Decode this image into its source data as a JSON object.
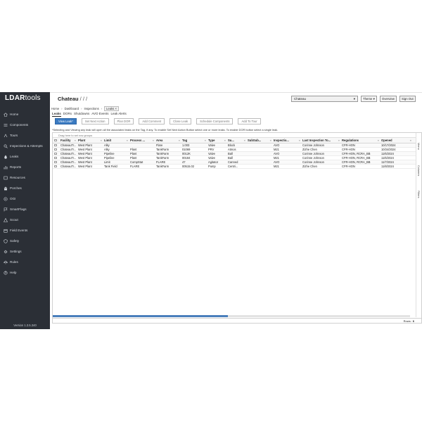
{
  "app": {
    "logo_bold": "LDAR",
    "logo_light": "tools",
    "version": "Version 1.3.5.340"
  },
  "sidebar": {
    "items": [
      {
        "label": "Home",
        "icon": "home-icon"
      },
      {
        "label": "Components",
        "icon": "components-icon"
      },
      {
        "label": "Tours",
        "icon": "tours-icon"
      },
      {
        "label": "Inspections & Attempts",
        "icon": "inspections-icon"
      },
      {
        "label": "Leaks",
        "icon": "leaks-icon"
      },
      {
        "label": "Reports",
        "icon": "reports-icon"
      },
      {
        "label": "Resources",
        "icon": "resources-icon"
      },
      {
        "label": "Porches",
        "icon": "porches-icon"
      },
      {
        "label": "OGI",
        "icon": "ogi-icon"
      },
      {
        "label": "SmartFlags",
        "icon": "flag-icon"
      },
      {
        "label": "Scout",
        "icon": "scout-icon"
      },
      {
        "label": "Field Events",
        "icon": "field-events-icon"
      },
      {
        "label": "Safety",
        "icon": "safety-icon"
      },
      {
        "label": "Settings",
        "icon": "gear-icon"
      },
      {
        "label": "Rules",
        "icon": "rules-icon"
      },
      {
        "label": "Help",
        "icon": "help-icon"
      }
    ]
  },
  "header": {
    "title": "Chateau",
    "title_suffix": " / / /",
    "site_value": "Chateau",
    "site_caret": "▾",
    "theme_label": "Theme ▾",
    "overview_label": "Overview",
    "signout_label": "Sign Out"
  },
  "breadcrumb": {
    "items": [
      "Home",
      "Dashboard",
      "Inspections"
    ],
    "sep": "›",
    "active": "Leaks",
    "close": "×"
  },
  "subtabs": [
    "Leaks",
    "DORs",
    "Shutdowns",
    "AVO Events",
    "Leak Alerts"
  ],
  "actions": {
    "view": "View Leak*",
    "next": "Set Next Action",
    "plan": "Plan DOR",
    "comment": "Add Comment",
    "close": "Close Leak",
    "schedule": "Schedule Components",
    "tour": "Add To Tour"
  },
  "hint": "*Selecting and Viewing any leak will open all the associated leaks on the Tag, if any. To enable Set Next Action Button select one or more leaks. To enable DOR button select a single leak.",
  "grid": {
    "group_panel": "Drag here to set row groups",
    "menu_glyph": "≡",
    "columns": [
      "Facility",
      "Plant",
      "Limit",
      "Process ...",
      "Area",
      "Tag",
      "Type",
      "Su...",
      "SubSub...",
      "Inspectio...",
      "Last Inspection To...",
      "Regulations",
      "Opened"
    ],
    "rows": [
      [
        "ChateauTr...",
        "West Plant",
        "Alky",
        "",
        "Flare",
        "1.003",
        "Valve",
        "Block",
        "",
        "AVO",
        "Corinne Johnson",
        "CFR-HON",
        "10/17/2024"
      ],
      [
        "ChateauTr...",
        "West Plant",
        "Alky",
        "Plant",
        "TankFarm",
        "01069",
        "PRV",
        "Atmos",
        "",
        "M21",
        "Zizhe Chen",
        "CFR-HON",
        "10/24/2024"
      ],
      [
        "ChateauTr...",
        "West Plant",
        "Pipeline",
        "Plant",
        "TankFarm",
        "0012K",
        "Valve",
        "Ball",
        "",
        "AVO",
        "Corinne Johnson",
        "CFR-HON, RCRA_BB",
        "11/6/2024"
      ],
      [
        "ChateauTr...",
        "West Plant",
        "Pipeline",
        "Plant",
        "TankFarm",
        "00184",
        "Valve",
        "Ball",
        "",
        "M21",
        "Corinne Johnson",
        "CFR-HON, RCRA_BB",
        "11/6/2024"
      ],
      [
        "ChateauTr...",
        "West Plant",
        "Limit",
        "CompStat",
        "FLARE",
        "47",
        "Agitator",
        "Canned",
        "",
        "AVO",
        "Corinne Johnson",
        "CFR-HON, RCRA_BB",
        "11/7/2024"
      ],
      [
        "ChateauTr...",
        "West Plant",
        "Tank Field",
        "FLARE",
        "TankFarm",
        "00515.02",
        "Pump",
        "Centri...",
        "",
        "M21",
        "Zizhe Chen",
        "CFR-HON",
        "11/8/2024"
      ]
    ],
    "side_tabs": [
      "Menu",
      "Columns",
      "Filters"
    ],
    "scroll_fraction": 0.49,
    "footer_label": "Rows:",
    "footer_count": "6"
  }
}
